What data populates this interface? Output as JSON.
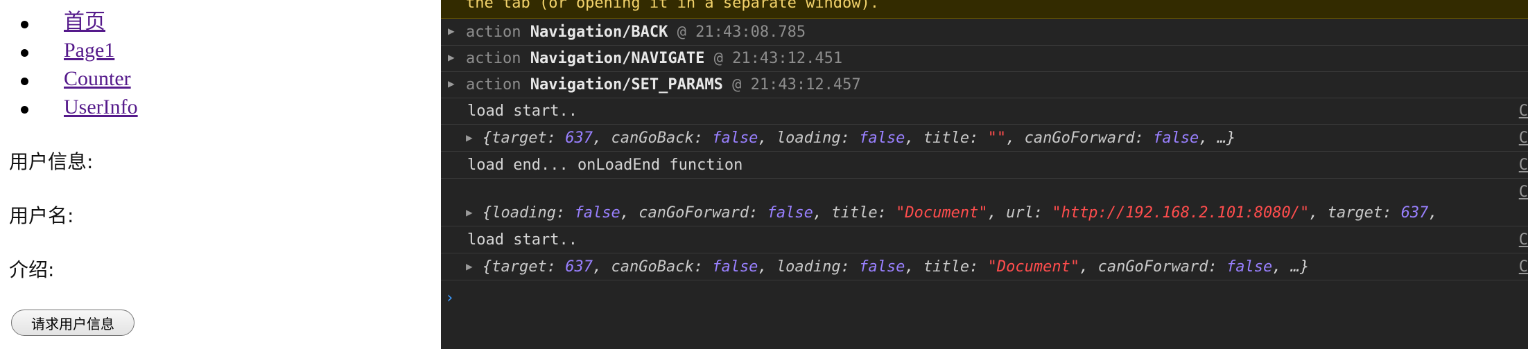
{
  "nav": {
    "items": [
      "首页",
      "Page1",
      "Counter",
      "UserInfo"
    ]
  },
  "user": {
    "info_label": "用户信息:",
    "name_label": "用户名:",
    "intro_label": "介绍:",
    "request_button": "请求用户信息"
  },
  "console": {
    "warning": "the tab (or opening it in a separate window).",
    "actions": [
      {
        "prefix": "action",
        "name": "Navigation/BACK",
        "at": "@",
        "time": "21:43:08.785"
      },
      {
        "prefix": "action",
        "name": "Navigation/NAVIGATE",
        "at": "@",
        "time": "21:43:12.451"
      },
      {
        "prefix": "action",
        "name": "Navigation/SET_PARAMS",
        "at": "@",
        "time": "21:43:12.457"
      }
    ],
    "log1": "load start..",
    "obj1": {
      "k1": "target",
      "v1": "637",
      "k2": "canGoBack",
      "v2": "false",
      "k3": "loading",
      "v3": "false",
      "k4": "title",
      "v4": "\"\"",
      "k5": "canGoForward",
      "v5": "false",
      "tail": "…}"
    },
    "log2": "load end... onLoadEnd function",
    "obj2": {
      "k1": "loading",
      "v1": "false",
      "k2": "canGoForward",
      "v2": "false",
      "k3": "title",
      "v3": "\"Document\"",
      "k4": "url",
      "v4": "\"http://192.168.2.101:8080/\"",
      "k5": "target",
      "v5": "637"
    },
    "log3": "load start..",
    "obj3": {
      "k1": "target",
      "v1": "637",
      "k2": "canGoBack",
      "v2": "false",
      "k3": "loading",
      "v3": "false",
      "k4": "title",
      "v4": "\"Document\"",
      "k5": "canGoForward",
      "v5": "false",
      "tail": "…}"
    },
    "source_ref": "C",
    "prompt": "›"
  }
}
